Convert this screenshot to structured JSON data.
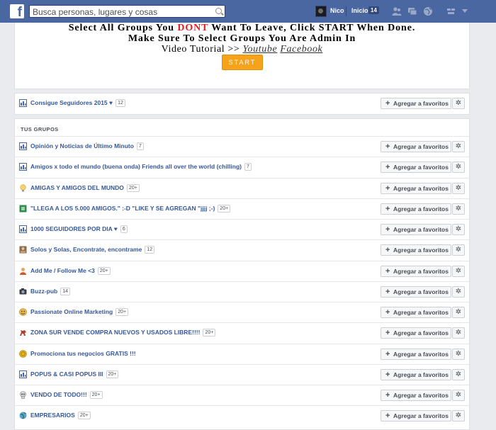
{
  "topbar": {
    "logo": "f",
    "search_placeholder": "Busca personas, lugares y cosas",
    "user_name": "Nico",
    "home_label": "Inicio",
    "home_count": "14"
  },
  "header": {
    "line1_pre": "Select All Groups You ",
    "line1_dont": "DONT",
    "line1_post": " Want To Leave, Click START When Done.",
    "line2": "Make Sure To Select Groups You Are Admin In",
    "video_prefix": "Video Tutorial >> ",
    "video_link1": "Youtube",
    "video_link2": "Facebook",
    "start_label": "START"
  },
  "favorite_label": "Agregar a favoritos",
  "pinned_group": {
    "name": "Consigue Seguidores 2015 ♥",
    "count": "12",
    "icon": "group-icon"
  },
  "section_title": "TUS GRUPOS",
  "groups": [
    {
      "name": "Opinión y Noticias de Último Minuto",
      "count": "7",
      "icon": "group-icon"
    },
    {
      "name": "Amigos x todo el mundo (buena onda) Friends all over the world (chilling)",
      "count": "7",
      "icon": "group-icon"
    },
    {
      "name": "AMIGAS Y AMIGOS DEL MUNDO",
      "count": "20+",
      "icon": "lightbulb-icon"
    },
    {
      "name": "\"LLEGA A LOS 5.000 AMIGOS.\" :-D \"LIKE Y SE AGREGAN \"jjjj ;-)",
      "count": "20+",
      "icon": "green-square-icon"
    },
    {
      "name": "1000 SEGUIDORES POR DIA ♥",
      "count": "6",
      "icon": "group-icon"
    },
    {
      "name": "Solos y Solas, Encontrate, encontrame",
      "count": "12",
      "icon": "photo-icon"
    },
    {
      "name": "Add Me / Follow Me <3",
      "count": "20+",
      "icon": "person-icon"
    },
    {
      "name": "Buzz-pub",
      "count": "14",
      "icon": "camera-icon"
    },
    {
      "name": "Passionate Online Marketing",
      "count": "20+",
      "icon": "smiley-icon"
    },
    {
      "name": "ZONA SUR VENDE COMPRA NUEVOS Y USADOS LIBRE!!!!",
      "count": "20+",
      "icon": "horse-icon"
    },
    {
      "name": "Promociona tus negocios GRATIS !!!",
      "count": "",
      "icon": "coin-icon"
    },
    {
      "name": "POPUS & CASI POPUS III",
      "count": "20+",
      "icon": "group-icon"
    },
    {
      "name": "VENDO DE TODO!!!",
      "count": "20+",
      "icon": "skull-icon"
    },
    {
      "name": "EMPRESARIOS",
      "count": "20+",
      "icon": "globe-icon"
    }
  ],
  "colors": {
    "topbar": "#4b67a1",
    "link": "#365899",
    "start": "#f7a21b",
    "dont": "#e41e1e"
  }
}
